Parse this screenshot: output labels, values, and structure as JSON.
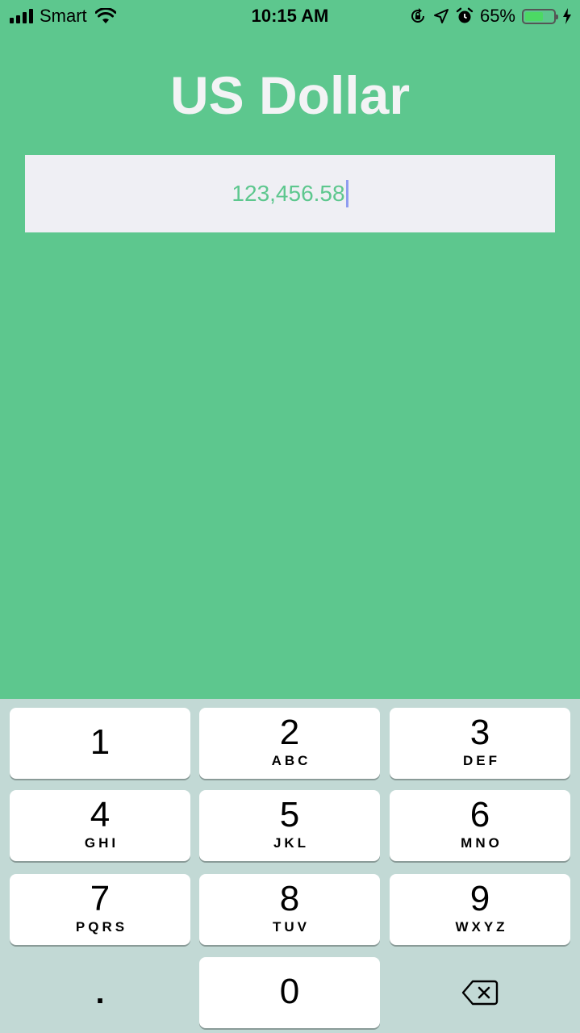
{
  "status_bar": {
    "carrier": "Smart",
    "time": "10:15 AM",
    "battery_percent": "65%",
    "battery_level": 0.65,
    "icons": [
      "signal-icon",
      "wifi-icon",
      "orientation-lock-icon",
      "location-icon",
      "alarm-icon",
      "battery-icon",
      "charging-icon"
    ]
  },
  "header": {
    "title": "US Dollar"
  },
  "amount_field": {
    "value": "123,456.58"
  },
  "keypad": {
    "keys": [
      {
        "digit": "1",
        "letters": ""
      },
      {
        "digit": "2",
        "letters": "ABC"
      },
      {
        "digit": "3",
        "letters": "DEF"
      },
      {
        "digit": "4",
        "letters": "GHI"
      },
      {
        "digit": "5",
        "letters": "JKL"
      },
      {
        "digit": "6",
        "letters": "MNO"
      },
      {
        "digit": "7",
        "letters": "PQRS"
      },
      {
        "digit": "8",
        "letters": "TUV"
      },
      {
        "digit": "9",
        "letters": "WXYZ"
      },
      {
        "digit": "0",
        "letters": ""
      }
    ],
    "decimal_label": ".",
    "backspace_icon": "backspace-icon"
  },
  "colors": {
    "background": "#5dc78e",
    "input_background": "#efeff4",
    "title_text": "#f3f3f5",
    "keypad_background": "#c2d9d5",
    "caret": "#8f9cf0"
  }
}
